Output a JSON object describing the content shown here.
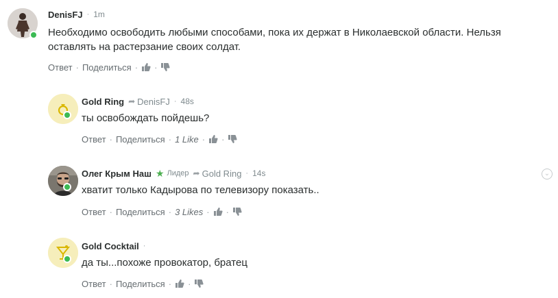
{
  "colors": {
    "online": "#3cba54",
    "star": "#4caf50",
    "gold_avatar_bg": "#f6eebb",
    "gold_icon": "#d9b700"
  },
  "comments": [
    {
      "author": "DenisFJ",
      "time": "1m",
      "text_line1": "Необходимо освободить любыми способами, пока их держат в Николаевской области. Нельзя",
      "text_line2": "оставлять на растерзание своих солдат.",
      "reply_label": "Ответ",
      "share_label": "Поделиться",
      "avatar_icon": "person-figure-icon"
    },
    {
      "author": "Gold Ring",
      "reply_to": "DenisFJ",
      "time": "48s",
      "text": "ты освобождать пойдешь?",
      "reply_label": "Ответ",
      "share_label": "Поделиться",
      "likes": "1 Like",
      "avatar_icon": "ring-icon"
    },
    {
      "author": "Олег Крым Наш",
      "badge": "Лидер",
      "reply_to": "Gold Ring",
      "time": "14s",
      "text": "хватит только Кадырова по телевизору показать..",
      "reply_label": "Ответ",
      "share_label": "Поделиться",
      "likes": "3 Likes",
      "avatar_icon": "bearded-man-photo"
    },
    {
      "author": "Gold Cocktail",
      "text": "да ты...похоже провокатор, братец",
      "reply_label": "Ответ",
      "share_label": "Поделиться",
      "avatar_icon": "cocktail-icon"
    }
  ]
}
